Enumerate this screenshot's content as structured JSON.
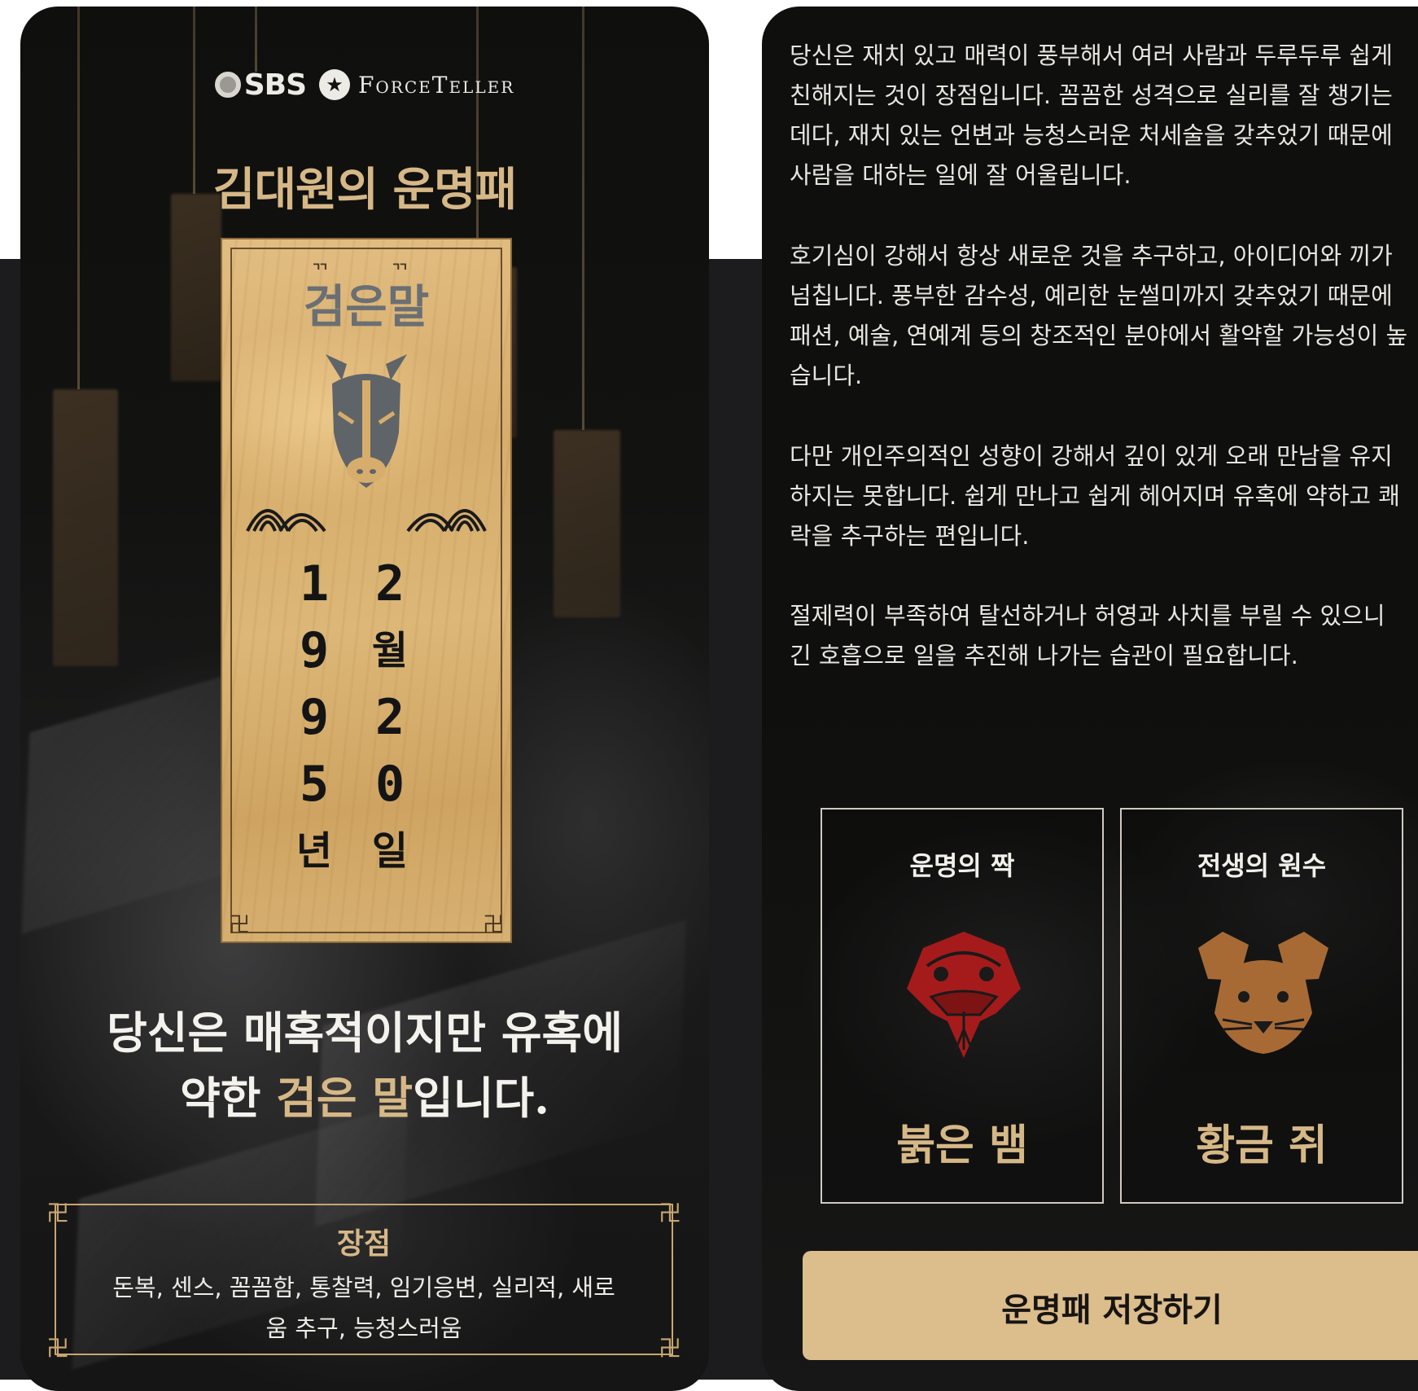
{
  "brand": {
    "sbs": "SBS",
    "forceteller": "ForceTeller"
  },
  "left": {
    "title": "김대원의 운명패",
    "plaque": {
      "zodiac_name": "검은말",
      "year_digits": [
        "1",
        "9",
        "9",
        "5",
        "년"
      ],
      "day_digits": [
        "2",
        "월",
        "2",
        "0",
        "일"
      ]
    },
    "headline": {
      "line1": "당신은 매혹적이지만 유혹에",
      "line2_pre": "약한 ",
      "line2_hl": "검은 말",
      "line2_post": "입니다."
    },
    "merits": {
      "title": "장점",
      "text": "돈복, 센스, 꼼꼼함, 통찰력, 임기응변, 실리적, 새로움 추구, 능청스러움"
    }
  },
  "right": {
    "paragraphs": [
      [
        "당신은 재치 있고 매력이 풍부해서 여러 사람과 두루두루 쉽게",
        "친해지는 것이 장점입니다. 꼼꼼한 성격으로 실리를 잘 챙기는",
        "데다, 재치 있는 언변과 능청스러운 처세술을 갖추었기 때문에",
        "사람을 대하는 일에 잘 어울립니다."
      ],
      [
        "호기심이 강해서 항상 새로운 것을 추구하고, 아이디어와 끼가",
        "넘칩니다. 풍부한 감수성, 예리한 눈썰미까지 갖추었기 때문에",
        "패션, 예술, 연예계 등의 창조적인 분야에서 활약할 가능성이 높",
        "습니다."
      ],
      [
        "다만 개인주의적인 성향이 강해서 깊이 있게 오래 만남을 유지",
        "하지는 못합니다. 쉽게 만나고 쉽게 헤어지며 유혹에 약하고 쾌",
        "락을 추구하는 편입니다."
      ],
      [
        "절제력이 부족하여 탈선하거나 허영과 사치를 부릴 수 있으니",
        "긴 호흡으로 일을 추진해 나가는 습관이 필요합니다."
      ]
    ],
    "destiny_match": {
      "label": "운명의 짝",
      "name": "붉은 뱀",
      "icon": "red-snake-icon",
      "color": "#a51b1b"
    },
    "past_enemy": {
      "label": "전생의 원수",
      "name": "황금 쥐",
      "icon": "golden-rat-icon",
      "color": "#a86a35"
    },
    "save_button": "운명패 저장하기"
  },
  "colors": {
    "accent_gold": "#d6b887",
    "button_bg": "#dcbd8c",
    "background": "#0f0f0d"
  }
}
